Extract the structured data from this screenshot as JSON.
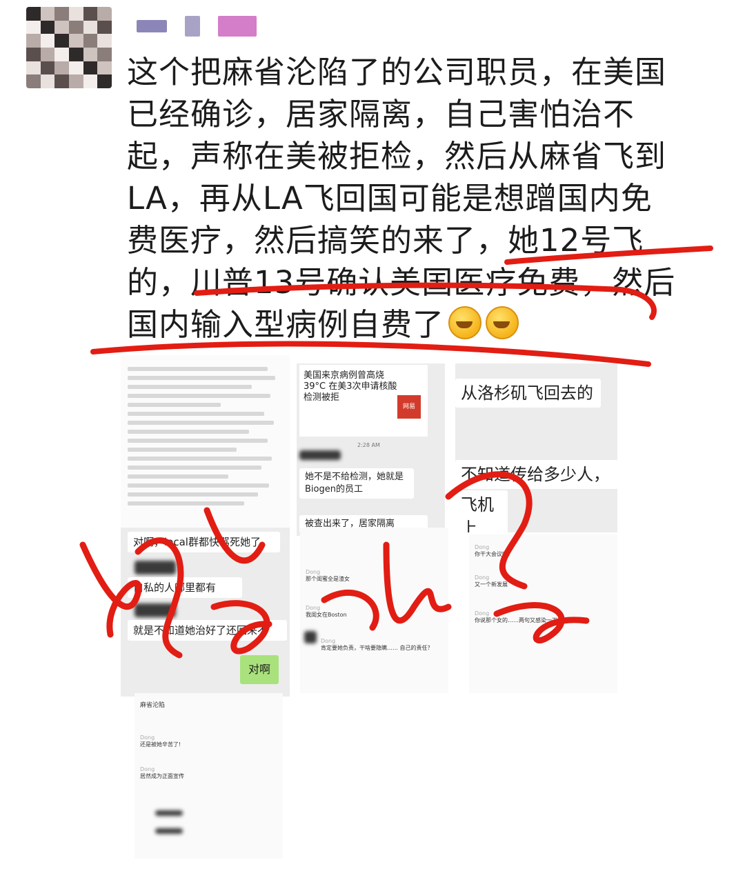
{
  "post": {
    "lines": [
      "这个把麻省沦陷了的公司职员，在美国",
      "已经确诊，居家隔离，自己害怕治不",
      "起，声称在美被拒检，然后从麻省飞到",
      "LA，再从LA飞回国可能是想蹭国内免",
      "费医疗，然后搞笑的来了，她12号飞",
      "的，川普13号确认美国医疗免费，然后",
      "国内输入型病例自费了"
    ],
    "emoji": "face-palm-emoji"
  },
  "screenshots": {
    "b": {
      "title": "美国来京病例曾高烧39°C 在美3次申请核酸检测被拒",
      "thumb": "网易",
      "time": "2:28 AM",
      "bubble1": "她不是不给检测，她就是 Biogen的员工",
      "bubble2": "被查出来了，居家隔离"
    },
    "c": {
      "bubble1": "从洛杉矶飞回去的",
      "bubble2": "不知道传给多少人，",
      "bubble3": "飞机上"
    },
    "d": {
      "bubble1": "对啊，local群都快骂死她了",
      "bubble2": "自私的人哪里都有",
      "bubble3": "就是不知道她治好了还回来不",
      "btn": "对啊"
    },
    "e": {
      "items": [
        "那个闺蜜全是渣女",
        "我闺女在Boston",
        "肯定要她负责，干啥要隐瞒…… 自己的责任？"
      ]
    },
    "f": {
      "items": [
        "你干大会议吗？",
        "又一个新发展",
        "你说那个女的……两句又感染一下午"
      ]
    },
    "g": {
      "header": "麻省沦陷",
      "items": [
        "还是被她辛苦了!",
        "居然成为正面宣传"
      ]
    }
  }
}
